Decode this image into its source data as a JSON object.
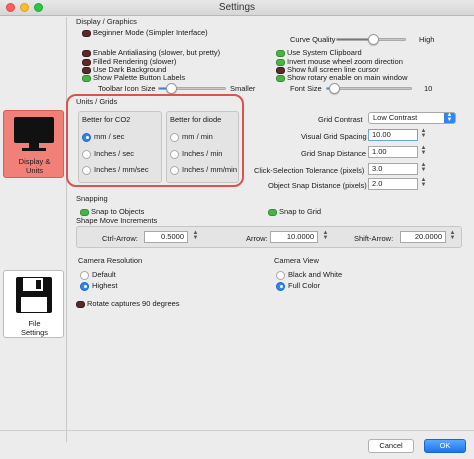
{
  "window": {
    "title": "Settings"
  },
  "sidebar": {
    "items": [
      {
        "label_line1": "Display &",
        "label_line2": "Units",
        "icon": "monitor-icon",
        "selected": true
      },
      {
        "label_line1": "File",
        "label_line2": "Settings",
        "icon": "floppy-disk-icon",
        "selected": false
      }
    ]
  },
  "display_graphics": {
    "title": "Display / Graphics",
    "left_options": [
      {
        "label": "Beginner Mode (Simpler Interface)",
        "on": false
      },
      {
        "label": "Enable Antialiasing (slower, but pretty)",
        "on": false
      },
      {
        "label": "Filled Rendering (slower)",
        "on": false
      },
      {
        "label": "Use Dark Background",
        "on": false
      },
      {
        "label": "Show Palette Button Labels",
        "on": true
      }
    ],
    "right_options": [
      {
        "label": "Use System Clipboard",
        "on": true
      },
      {
        "label": "Invert mouse wheel zoom direction",
        "on": true
      },
      {
        "label": "Show full screen line cursor",
        "on": false
      },
      {
        "label": "Show rotary enable on main window",
        "on": true
      }
    ],
    "curve_quality": {
      "label": "Curve Quality",
      "max_label": "High",
      "level": 0.55
    },
    "toolbar_icon_size": {
      "label": "Toolbar Icon Size",
      "max_label": "Smaller",
      "level": 0.2
    },
    "font_size": {
      "label": "Font Size",
      "value": "10",
      "level": 0.1
    }
  },
  "units_grids": {
    "title": "Units / Grids",
    "co2_heading": "Better for CO2",
    "diode_heading": "Better for diode",
    "co2_options": [
      {
        "label": "mm / sec",
        "selected": true
      },
      {
        "label": "Inches / sec",
        "selected": false
      },
      {
        "label": "Inches / mm/sec",
        "selected": false
      }
    ],
    "diode_options": [
      {
        "label": "mm / min",
        "selected": false
      },
      {
        "label": "Inches / min",
        "selected": false
      },
      {
        "label": "Inches / mm/min",
        "selected": false
      }
    ],
    "grid_contrast": {
      "label": "Grid Contrast",
      "value": "Low Contrast"
    },
    "visual_grid_spacing": {
      "label": "Visual Grid Spacing",
      "value": "10.00"
    },
    "grid_snap_distance": {
      "label": "Grid Snap Distance",
      "value": "1.00"
    },
    "click_selection_tolerance": {
      "label": "Click-Selection Tolerance (pixels)",
      "value": "3.0"
    },
    "object_snap_distance": {
      "label": "Object Snap Distance (pixels)",
      "value": "2.0"
    }
  },
  "snapping": {
    "title": "Snapping",
    "snap_objects": {
      "label": "Snap to Objects",
      "on": true
    },
    "snap_grid": {
      "label": "Snap to Grid",
      "on": true
    }
  },
  "shape_move": {
    "title": "Shape Move Increments",
    "ctrl_arrow": {
      "label": "Ctrl-Arrow:",
      "value": "0.5000"
    },
    "arrow": {
      "label": "Arrow:",
      "value": "10.0000"
    },
    "shift_arrow": {
      "label": "Shift-Arrow:",
      "value": "20.0000"
    }
  },
  "camera_resolution": {
    "title": "Camera Resolution",
    "options": [
      {
        "label": "Default",
        "selected": false
      },
      {
        "label": "Highest",
        "selected": true
      }
    ]
  },
  "camera_view": {
    "title": "Camera View",
    "options": [
      {
        "label": "Black and White",
        "selected": false
      },
      {
        "label": "Full Color",
        "selected": true
      }
    ]
  },
  "rotate_captures": {
    "label": "Rotate captures 90 degrees",
    "on": false
  },
  "footer": {
    "cancel_label": "Cancel",
    "ok_label": "OK"
  },
  "colors": {
    "accent": "#2f86ef",
    "toggle_on": "#49b349",
    "toggle_off": "#5a2a2a",
    "highlight": "#d9534f",
    "selected_tab": "#f08078"
  }
}
